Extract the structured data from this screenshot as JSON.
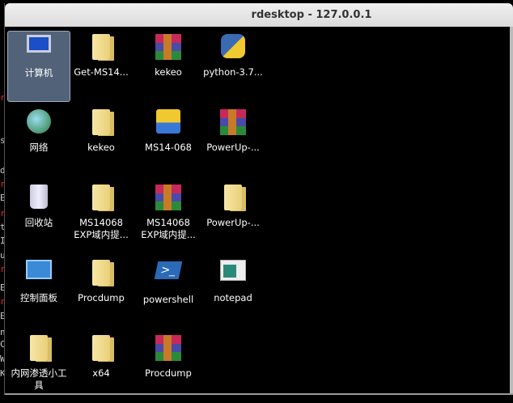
{
  "window": {
    "title": "rdesktop - 127.0.0.1"
  },
  "left_edge_letters": [
    "r",
    "s",
    "d",
    "r",
    "E",
    "r",
    "t",
    "I",
    "u",
    "r",
    "E",
    "r",
    "E",
    "n",
    "C",
    "W",
    "K"
  ],
  "desktop": {
    "icons": [
      {
        "label": "计算机",
        "icon": "computer-icon",
        "selected": true
      },
      {
        "label": "Get-MS14...",
        "icon": "folder-icon"
      },
      {
        "label": "kekeo",
        "icon": "winrar-archive-icon"
      },
      {
        "label": "python-3.7...",
        "icon": "python-installer-icon"
      },
      {
        "label": "网络",
        "icon": "network-icon"
      },
      {
        "label": "kekeo",
        "icon": "folder-icon"
      },
      {
        "label": "MS14-068",
        "icon": "python-script-icon"
      },
      {
        "label": "PowerUp-...",
        "icon": "winrar-archive-icon"
      },
      {
        "label": "回收站",
        "icon": "recycle-bin-icon"
      },
      {
        "label": "MS14068 EXP域内提...",
        "icon": "folder-icon"
      },
      {
        "label": "MS14068 EXP域内提...",
        "icon": "winrar-archive-icon"
      },
      {
        "label": "PowerUp-...",
        "icon": "folder-icon"
      },
      {
        "label": "控制面板",
        "icon": "control-panel-icon"
      },
      {
        "label": "Procdump",
        "icon": "folder-icon"
      },
      {
        "label": "powershell",
        "icon": "powershell-icon"
      },
      {
        "label": "notepad",
        "icon": "notepad-icon"
      },
      {
        "label": "内网渗透小工具",
        "icon": "folder-icon"
      },
      {
        "label": "x64",
        "icon": "folder-icon"
      },
      {
        "label": "Procdump",
        "icon": "winrar-archive-icon"
      }
    ]
  }
}
